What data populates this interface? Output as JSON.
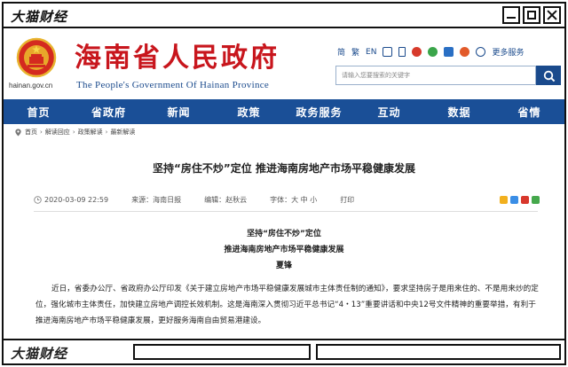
{
  "window": {
    "title": "大猫财经",
    "bottom_title": "大猫财经"
  },
  "site": {
    "domain": "hainan.gov.cn",
    "name_cn": "海南省人民政府",
    "name_en": "The People's Government Of Hainan Province",
    "tools": [
      "简",
      "繁",
      "EN"
    ],
    "more_services": "更多服务",
    "search_placeholder": "请输入您要搜索的关键字",
    "colors": {
      "nav": "#1a4f97",
      "brand_red": "#c8161d",
      "link_blue": "#1a4a8c"
    }
  },
  "nav": {
    "items": [
      "首页",
      "省政府",
      "新闻",
      "政策",
      "政务服务",
      "互动",
      "数据",
      "省情"
    ]
  },
  "breadcrumb": [
    "首页",
    "解读回应",
    "政策解读",
    "最新解读"
  ],
  "article": {
    "title": "坚持“房住不炒”定位 推进海南房地产市场平稳健康发展",
    "date": "2020-03-09 22:59",
    "source_label": "来源：",
    "source": "海南日报",
    "editor_label": "编辑：",
    "editor": "赵秋云",
    "font_label": "字体：",
    "font_sizes": [
      "大",
      "中",
      "小"
    ],
    "print": "打印",
    "sub_lines": [
      "坚持“房住不炒”定位",
      "推进海南房地产市场平稳健康发展",
      "夏锋"
    ],
    "body": "近日，省委办公厅、省政府办公厅印发《关于建立房地产市场平稳健康发展城市主体责任制的通知》，要求坚持房子是用来住的、不是用来炒的定位，强化城市主体责任，加快建立房地产调控长效机制。这是海南深入贯彻习近平总书记“4・13”重要讲话和中央12号文件精神的重要举措，有利于推进海南房地产市场平稳健康发展，更好服务海南自由贸易港建设。"
  }
}
